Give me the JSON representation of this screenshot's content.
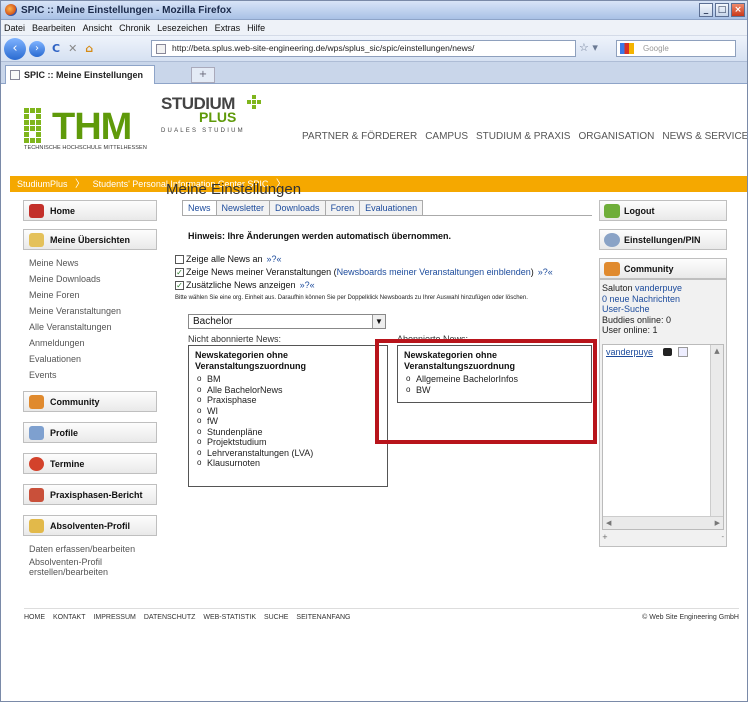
{
  "window": {
    "title": "SPIC :: Meine Einstellungen - Mozilla Firefox"
  },
  "menu": [
    "Datei",
    "Bearbeiten",
    "Ansicht",
    "Chronik",
    "Lesezeichen",
    "Extras",
    "Hilfe"
  ],
  "browser": {
    "url": "http://beta.splus.web-site-engineering.de/wps/splus_sic/spic/einstellungen/news/",
    "search_placeholder": "Google",
    "tab_title": "SPIC :: Meine Einstellungen",
    "new_tab": "+"
  },
  "header": {
    "thm": "THM",
    "thm_sub": "TECHNISCHE HOCHSCHULE MITTELHESSEN",
    "studium": "STUDIUM",
    "plus": "PLUS",
    "duales": "DUALES STUDIUM",
    "nav": [
      "PARTNER & FÖRDERER",
      "CAMPUS",
      "STUDIUM & PRAXIS",
      "ORGANISATION",
      "NEWS & SERVICE"
    ]
  },
  "breadcrumb": [
    "StudiumPlus",
    "Students' Personal Information Center SPIC"
  ],
  "left": {
    "home": "Home",
    "uebersichten": "Meine Übersichten",
    "uebersichten_items": [
      "Meine News",
      "Meine Downloads",
      "Meine Foren",
      "Meine Veranstaltungen",
      "Alle Veranstaltungen",
      "Anmeldungen",
      "Evaluationen",
      "Events"
    ],
    "community": "Community",
    "profile": "Profile",
    "termine": "Termine",
    "praxisphasen": "Praxisphasen-Bericht",
    "absolventen": "Absolventen-Profil",
    "absolventen_items": [
      "Daten erfassen/bearbeiten",
      "Absolventen-Profil",
      "erstellen/bearbeiten"
    ]
  },
  "main": {
    "title": "Meine Einstellungen",
    "tabs": [
      "News",
      "Newsletter",
      "Downloads",
      "Foren",
      "Evaluationen"
    ],
    "hint": "Hinweis: Ihre Änderungen werden automatisch übernommen.",
    "opt1": "Zeige alle News an",
    "opt2_a": "Zeige News meiner Veranstaltungen (",
    "opt2_link": "Newsboards meiner Veranstaltungen einblenden",
    "opt2_b": ")",
    "opt3": "Zusätzliche News anzeigen",
    "help": "»?«",
    "check": "✓",
    "small_note": "Bitte wählen Sie eine org. Einheit aus. Daraufhin können Sie per Doppelklick Newsboards zu Ihrer Auswahl hinzufügen oder löschen.",
    "select_value": "Bachelor",
    "not_subscribed_label": "Nicht abonnierte News:",
    "subscribed_label": "Abonnierte News:",
    "box_heading_1": "Newskategorien ohne",
    "box_heading_2": "Veranstaltungszuordnung",
    "not_subscribed": [
      "BM",
      "Alle BachelorNews",
      "Praxisphase",
      "WI",
      "fW",
      "Stundenpläne",
      "Projektstudium",
      "Lehrveranstaltungen (LVA)",
      "Klausurnoten"
    ],
    "subscribed": [
      "Allgemeine BachelorInfos",
      "BW"
    ]
  },
  "right": {
    "logout": "Logout",
    "settings": "Einstellungen/PIN",
    "community": "Community",
    "greeting_prefix": "Saluton ",
    "user": "vanderpuye",
    "messages_count": "0",
    "messages_text": " neue Nachrichten",
    "user_search": "User-Suche",
    "buddies": "Buddies online: 0",
    "users_online": "User online: 1"
  },
  "footer": {
    "links": [
      "HOME",
      "KONTAKT",
      "IMPRESSUM",
      "DATENSCHUTZ",
      "WEB-STATISTIK",
      "SUCHE",
      "SEITENANFANG"
    ],
    "copyright": "© Web Site Engineering GmbH"
  },
  "colors": {
    "accent_orange": "#f5a800",
    "thm_green": "#5f9a0a",
    "highlight_red": "#b8141b",
    "link_blue": "#1c4b9c"
  }
}
